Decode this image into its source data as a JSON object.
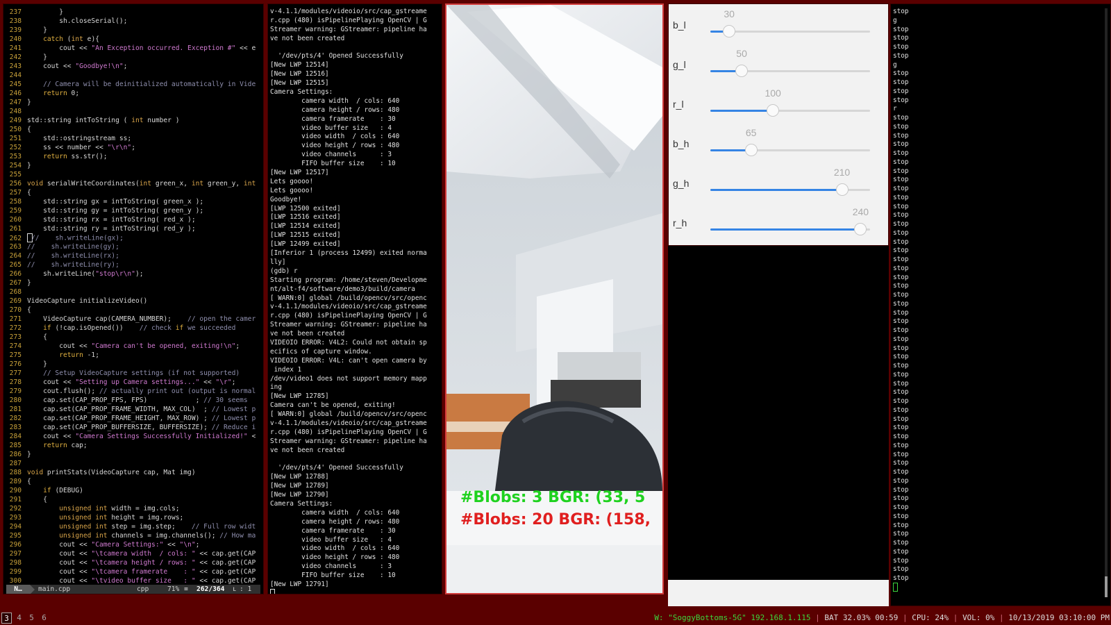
{
  "editor": {
    "lines": [
      {
        "n": "237",
        "t": "        }"
      },
      {
        "n": "238",
        "t": "        sh.closeSerial();"
      },
      {
        "n": "239",
        "t": "    }"
      },
      {
        "n": "240",
        "t": "    catch (int e){"
      },
      {
        "n": "241",
        "t": "        cout << \"An Exception occurred. Exception #\" << e"
      },
      {
        "n": "242",
        "t": "    }"
      },
      {
        "n": "243",
        "t": "    cout << \"Goodbye!\\n\";"
      },
      {
        "n": "244",
        "t": ""
      },
      {
        "n": "245",
        "t": "    // Camera will be deinitialized automatically in Vide"
      },
      {
        "n": "246",
        "t": "    return 0;"
      },
      {
        "n": "247",
        "t": "}"
      },
      {
        "n": "248",
        "t": ""
      },
      {
        "n": "249",
        "t": "std::string intToString ( int number )"
      },
      {
        "n": "250",
        "t": "{"
      },
      {
        "n": "251",
        "t": "    std::ostringstream ss;"
      },
      {
        "n": "252",
        "t": "    ss << number << \"\\r\\n\";"
      },
      {
        "n": "253",
        "t": "    return ss.str();"
      },
      {
        "n": "254",
        "t": "}"
      },
      {
        "n": "255",
        "t": ""
      },
      {
        "n": "256",
        "t": "void serialWriteCoordinates(int green_x, int green_y, int"
      },
      {
        "n": "257",
        "t": "{"
      },
      {
        "n": "258",
        "t": "    std::string gx = intToString( green_x );"
      },
      {
        "n": "259",
        "t": "    std::string gy = intToString( green_y );"
      },
      {
        "n": "260",
        "t": "    std::string rx = intToString( red_x );"
      },
      {
        "n": "261",
        "t": "    std::string ry = intToString( red_y );"
      },
      {
        "n": "262",
        "t": "//    sh.writeLine(gx);",
        "cursor": true
      },
      {
        "n": "263",
        "t": "//    sh.writeLine(gy);"
      },
      {
        "n": "264",
        "t": "//    sh.writeLine(rx);"
      },
      {
        "n": "265",
        "t": "//    sh.writeLine(ry);"
      },
      {
        "n": "266",
        "t": "    sh.writeLine(\"stop\\r\\n\");"
      },
      {
        "n": "267",
        "t": "}"
      },
      {
        "n": "268",
        "t": ""
      },
      {
        "n": "269",
        "t": "VideoCapture initializeVideo()"
      },
      {
        "n": "270",
        "t": "{"
      },
      {
        "n": "271",
        "t": "    VideoCapture cap(CAMERA_NUMBER);    // open the camer"
      },
      {
        "n": "272",
        "t": "    if (!cap.isOpened())    // check if we succeeded"
      },
      {
        "n": "273",
        "t": "    {"
      },
      {
        "n": "274",
        "t": "        cout << \"Camera can't be opened, exiting!\\n\";"
      },
      {
        "n": "275",
        "t": "        return -1;"
      },
      {
        "n": "276",
        "t": "    }"
      },
      {
        "n": "277",
        "t": "    // Setup VideoCapture settings (if not supported)"
      },
      {
        "n": "278",
        "t": "    cout << \"Setting up Camera settings...\" << \"\\r\";"
      },
      {
        "n": "279",
        "t": "    cout.flush(); // actually print out (output is normal"
      },
      {
        "n": "280",
        "t": "    cap.set(CAP_PROP_FPS, FPS)            ; // 30 seems"
      },
      {
        "n": "281",
        "t": "    cap.set(CAP_PROP_FRAME_WIDTH, MAX_COL)  ; // Lowest p"
      },
      {
        "n": "282",
        "t": "    cap.set(CAP_PROP_FRAME_HEIGHT, MAX_ROW) ; // Lowest p"
      },
      {
        "n": "283",
        "t": "    cap.set(CAP_PROP_BUFFERSIZE, BUFFERSIZE); // Reduce i"
      },
      {
        "n": "284",
        "t": "    cout << \"Camera Settings Successfully Initialized!\" <"
      },
      {
        "n": "285",
        "t": "    return cap;"
      },
      {
        "n": "286",
        "t": "}"
      },
      {
        "n": "287",
        "t": ""
      },
      {
        "n": "288",
        "t": "void printStats(VideoCapture cap, Mat img)"
      },
      {
        "n": "289",
        "t": "{"
      },
      {
        "n": "290",
        "t": "    if (DEBUG)"
      },
      {
        "n": "291",
        "t": "    {"
      },
      {
        "n": "292",
        "t": "        unsigned int width = img.cols;"
      },
      {
        "n": "293",
        "t": "        unsigned int height = img.rows;"
      },
      {
        "n": "294",
        "t": "        unsigned int step = img.step;    // Full row widt"
      },
      {
        "n": "295",
        "t": "        unsigned int channels = img.channels(); // How ma"
      },
      {
        "n": "296",
        "t": "        cout << \"Camera Settings:\" << \"\\n\";"
      },
      {
        "n": "297",
        "t": "        cout << \"\\tcamera width  / cols: \" << cap.get(CAP"
      },
      {
        "n": "298",
        "t": "        cout << \"\\tcamera height / rows: \" << cap.get(CAP"
      },
      {
        "n": "299",
        "t": "        cout << \"\\tcamera framerate    : \" << cap.get(CAP"
      },
      {
        "n": "300",
        "t": "        cout << \"\\tvideo buffer size   : \" << cap.get(CAP"
      }
    ],
    "status": {
      "mode": "N…",
      "file": "main.cpp",
      "filetype": "cpp",
      "percent": "71%",
      "position": "262/364",
      "column": ":  1"
    }
  },
  "terminal": {
    "lines": [
      "v-4.1.1/modules/videoio/src/cap_gstreame",
      "r.cpp (480) isPipelinePlaying OpenCV | G",
      "Streamer warning: GStreamer: pipeline ha",
      "ve not been created",
      "",
      "  '/dev/pts/4' Opened Successfully",
      "[New LWP 12514]",
      "[New LWP 12516]",
      "[New LWP 12515]",
      "Camera Settings:",
      "        camera width  / cols: 640",
      "        camera height / rows: 480",
      "        camera framerate    : 30",
      "        video buffer size   : 4",
      "        video width  / cols : 640",
      "        video height / rows : 480",
      "        video channels      : 3",
      "        FIFO buffer size    : 10",
      "[New LWP 12517]",
      "Lets goooo!",
      "Lets goooo!",
      "Goodbye!",
      "[LWP 12500 exited]",
      "[LWP 12516 exited]",
      "[LWP 12514 exited]",
      "[LWP 12515 exited]",
      "[LWP 12499 exited]",
      "[Inferior 1 (process 12499) exited norma",
      "lly]",
      "(gdb) r",
      "Starting program: /home/steven/Developme",
      "nt/alt-f4/software/demo3/build/camera",
      "[ WARN:0] global /build/opencv/src/openc",
      "v-4.1.1/modules/videoio/src/cap_gstreame",
      "r.cpp (480) isPipelinePlaying OpenCV | G",
      "Streamer warning: GStreamer: pipeline ha",
      "ve not been created",
      "VIDEOIO ERROR: V4L2: Could not obtain sp",
      "ecifics of capture window.",
      "VIDEOIO ERROR: V4L: can't open camera by",
      " index 1",
      "/dev/video1 does not support memory mapp",
      "ing",
      "[New LWP 12785]",
      "Camera can't be opened, exiting!",
      "[ WARN:0] global /build/opencv/src/openc",
      "v-4.1.1/modules/videoio/src/cap_gstreame",
      "r.cpp (480) isPipelinePlaying OpenCV | G",
      "Streamer warning: GStreamer: pipeline ha",
      "ve not been created",
      "",
      "  '/dev/pts/4' Opened Successfully",
      "[New LWP 12788]",
      "[New LWP 12789]",
      "[New LWP 12790]",
      "Camera Settings:",
      "        camera width  / cols: 640",
      "        camera height / rows: 480",
      "        camera framerate    : 30",
      "        video buffer size   : 4",
      "        video width  / cols : 640",
      "        video height / rows : 480",
      "        video channels      : 3",
      "        FIFO buffer size    : 10",
      "[New LWP 12791]"
    ]
  },
  "camera": {
    "blob_green": "#Blobs: 3 BGR: (33, 5",
    "blob_red": "#Blobs: 20 BGR: (158,",
    "green_color": "#1fd21f",
    "red_color": "#e01f1f"
  },
  "sliders": [
    {
      "label": "b_l",
      "value": "30",
      "fraction": 0.118
    },
    {
      "label": "g_l",
      "value": "50",
      "fraction": 0.196
    },
    {
      "label": "r_l",
      "value": "100",
      "fraction": 0.392
    },
    {
      "label": "b_h",
      "value": "65",
      "fraction": 0.255
    },
    {
      "label": "g_h",
      "value": "210",
      "fraction": 0.824
    },
    {
      "label": "r_h",
      "value": "240",
      "fraction": 0.941
    }
  ],
  "serial": {
    "lines": [
      "stop",
      "g",
      "stop",
      "stop",
      "stop",
      "stop",
      "g",
      "stop",
      "stop",
      "stop",
      "stop",
      "r",
      "stop",
      "stop",
      "stop",
      "stop",
      "stop",
      "stop",
      "stop",
      "stop",
      "stop",
      "stop",
      "stop",
      "stop",
      "stop",
      "stop",
      "stop",
      "stop",
      "stop",
      "stop",
      "stop",
      "stop",
      "stop",
      "stop",
      "stop",
      "stop",
      "stop",
      "stop",
      "stop",
      "stop",
      "stop",
      "stop",
      "stop",
      "stop",
      "stop",
      "stop",
      "stop",
      "stop",
      "stop",
      "stop",
      "stop",
      "stop",
      "stop",
      "stop",
      "stop",
      "stop",
      "stop",
      "stop",
      "stop",
      "stop",
      "stop",
      "stop",
      "stop",
      "stop",
      "stop"
    ]
  },
  "bar": {
    "workspaces": [
      "3",
      "4",
      "5",
      "6"
    ],
    "active_workspace": "3",
    "wifi": "W: \"SoggyBottoms-5G\" 192.168.1.115",
    "battery": "BAT 32.03% 00:59",
    "cpu": "CPU: 24%",
    "volume": "VOL: 0%",
    "datetime": "10/13/2019 03:10:00 PM"
  }
}
